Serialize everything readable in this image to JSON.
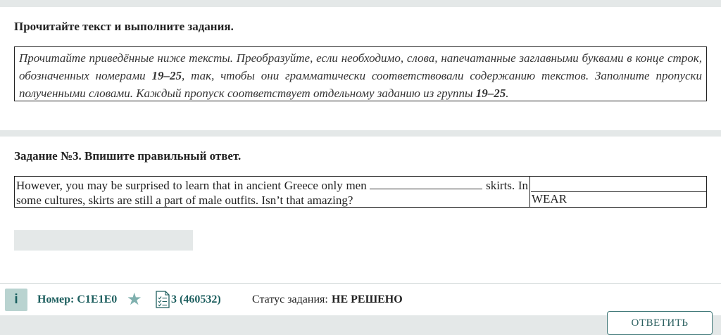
{
  "section1": {
    "heading": "Прочитайте текст и выполните задания.",
    "instr_part1": "Прочитайте приведённые ниже тексты. Преобразуйте, если необходимо, слова, напечатанные заглавными буквами в конце строк, обозначенных номерами ",
    "instr_range1": "19–25",
    "instr_part2": ", так, чтобы они грамматически соответствовали содержанию текстов. Заполните пропуски полученными словами. Каждый пропуск соответствует отдельному заданию из группы ",
    "instr_range2": "19–25",
    "instr_part3": "."
  },
  "section2": {
    "heading": "Задание №3. Впишите правильный ответ.",
    "sentence_before": "However, you may be surprised to learn that in ancient Greece only men ",
    "sentence_after": " skirts. In some cultures, skirts are still a part of male outfits. Isn’t that amazing?",
    "word": "WEAR",
    "answer_value": ""
  },
  "footer": {
    "info_label": "i",
    "number": "Номер: C1E1E0",
    "doc_number": "3 (460532)",
    "status_label": "Статус задания:",
    "status_value": "НЕ РЕШЕНО",
    "answer_button": "ОТВЕТИТЬ"
  },
  "icons": {
    "star": "star-icon",
    "doc": "document-list-icon"
  },
  "colors": {
    "accent": "#1e5f5f",
    "star": "#7fb0ae",
    "info_bg": "#b9d3d0"
  }
}
